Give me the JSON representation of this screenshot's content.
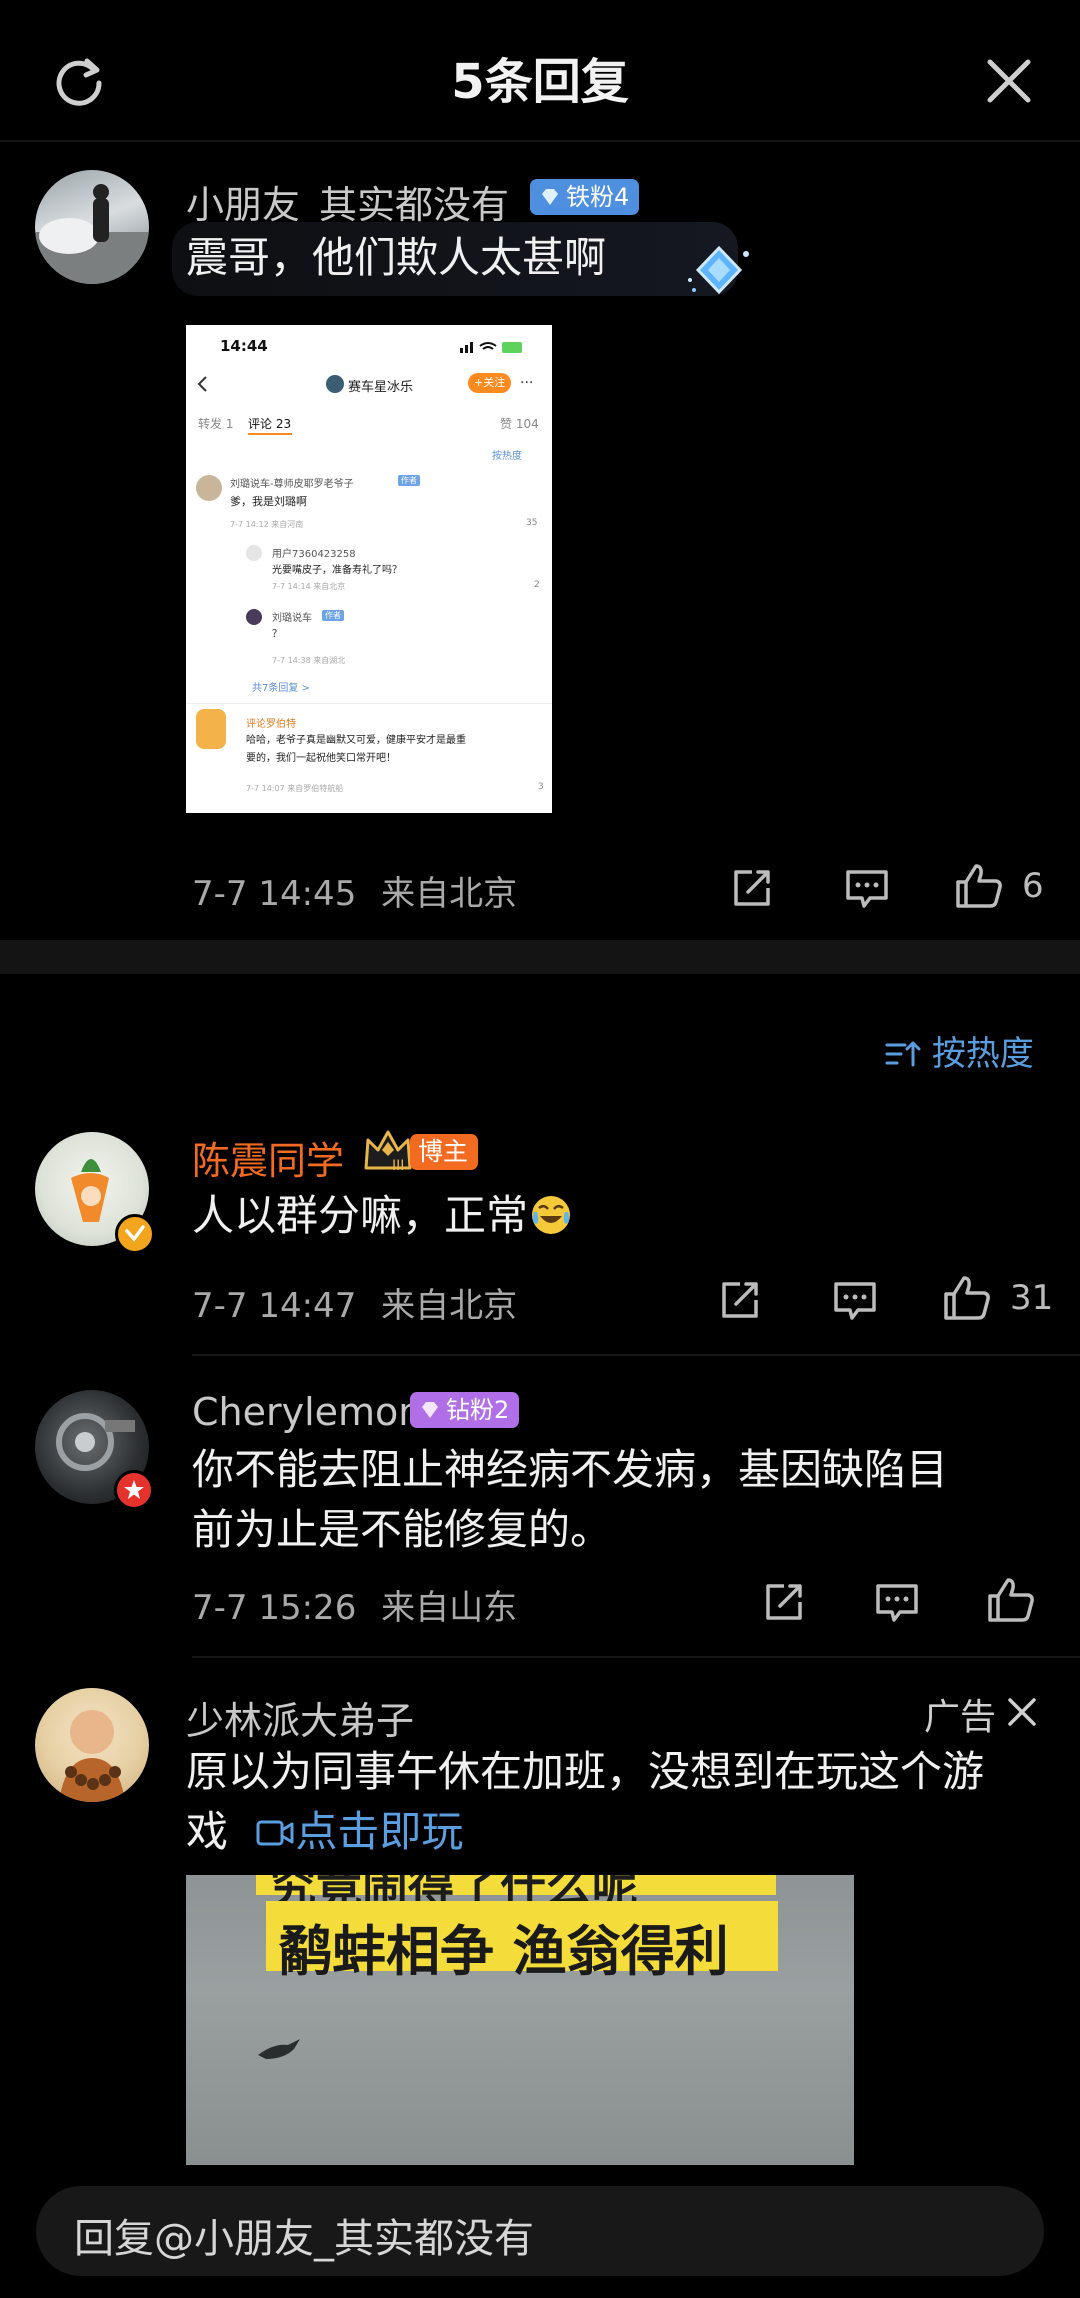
{
  "header": {
    "title": "5条回复",
    "refresh_icon": "refresh-icon",
    "close_icon": "close-icon"
  },
  "main_comment": {
    "username": "小朋友_其实都没有",
    "badge": "铁粉4",
    "text": "震哥，他们欺人太甚啊",
    "time": "7-7 14:45",
    "location": "来自北京",
    "likes": "6",
    "image": {
      "status_time": "14:44",
      "account": "赛车星冰乐",
      "follow": "+关注",
      "tab_repost": "转发 1",
      "tab_comment": "评论 23",
      "tab_like": "赞 104",
      "sort": "按热度",
      "c1_name": "刘璐说车-尊师皮耶罗老爷子",
      "c1_tag": "作者",
      "c1_text": "爹，我是刘璐啊",
      "c1_meta": "7-7 14:12 来自河南",
      "c1_likes": "35",
      "r1_name": "用户7360423258",
      "r1_text": "光要嘴皮子，准备寿礼了吗？",
      "r1_meta": "7-7 14:14 来自北京",
      "r1_likes": "2",
      "r2_name": "刘璐说车",
      "r2_tag": "作者",
      "r2_text": "？",
      "r2_meta": "7-7 14:38 来自湖北",
      "more": "共7条回复 >",
      "c2_name": "评论罗伯特",
      "c2_text1": "哈哈，老爷子真是幽默又可爱，健康平安才是最重",
      "c2_text2": "要的，我们一起祝他笑口常开吧！",
      "c2_meta": "7-7 14:07 来自罗伯特航船",
      "c2_likes": "3"
    }
  },
  "sort_label": "按热度",
  "replies": [
    {
      "username": "陈震同学",
      "badge": "博主",
      "text": "人以群分嘛，正常",
      "time": "7-7 14:47",
      "location": "来自北京",
      "likes": "31"
    },
    {
      "username": "Cherylemon",
      "badge": "钻粉2",
      "text1": "你不能去阻止神经病不发病，基因缺陷目",
      "text2": "前为止是不能修复的。",
      "time": "7-7 15:26",
      "location": "来自山东",
      "likes": ""
    }
  ],
  "ad": {
    "username": "少林派大弟子",
    "ad_label": "广告",
    "text1": "原以为同事午休在加班，没想到在玩这个游",
    "text2": "戏",
    "cta": "点击即玩",
    "image_caption1": "究竟闹得了什么呢",
    "image_caption2": "鹬蚌相争 渔翁得利"
  },
  "reply_input": {
    "placeholder": "回复@小朋友_其实都没有"
  },
  "colors": {
    "background": "#000000",
    "accent_blue": "#5a9ee0",
    "blogger_orange": "#f26b21",
    "badge_blue": "#4f8fe0",
    "badge_purple": "#b06fe6"
  }
}
